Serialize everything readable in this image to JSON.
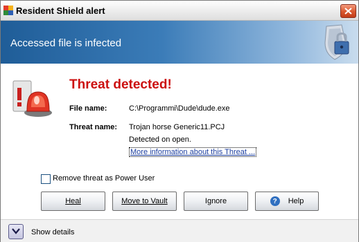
{
  "window": {
    "title": "Resident Shield alert"
  },
  "header": {
    "subtitle": "Accessed file is infected"
  },
  "alert": {
    "title": "Threat detected!",
    "file_name_label": "File name:",
    "file_name_value": "C:\\Programmi\\Dude\\dude.exe",
    "threat_name_label": "Threat name:",
    "threat_name_value": "Trojan horse Generic11.PCJ",
    "detected_text": "Detected on open.",
    "more_info_link": "More information about this Threat ..."
  },
  "options": {
    "remove_as_power_user_label": "Remove threat as Power User",
    "remove_as_power_user_checked": false
  },
  "buttons": {
    "heal_label": "Heal",
    "move_to_vault_label": "Move to Vault",
    "ignore_label": "Ignore",
    "help_label": "Help"
  },
  "footer": {
    "show_details_label": "Show details"
  },
  "icons": {
    "app": "avg-logo-icon",
    "close": "close-icon",
    "header": "shield-lock-icon",
    "alert": "alarm-siren-icon",
    "help": "help-icon",
    "details": "chevron-down-icon"
  },
  "colors": {
    "accent": "#cc1010",
    "header_blue": "#1f5d98",
    "link": "#1c3fa0"
  }
}
